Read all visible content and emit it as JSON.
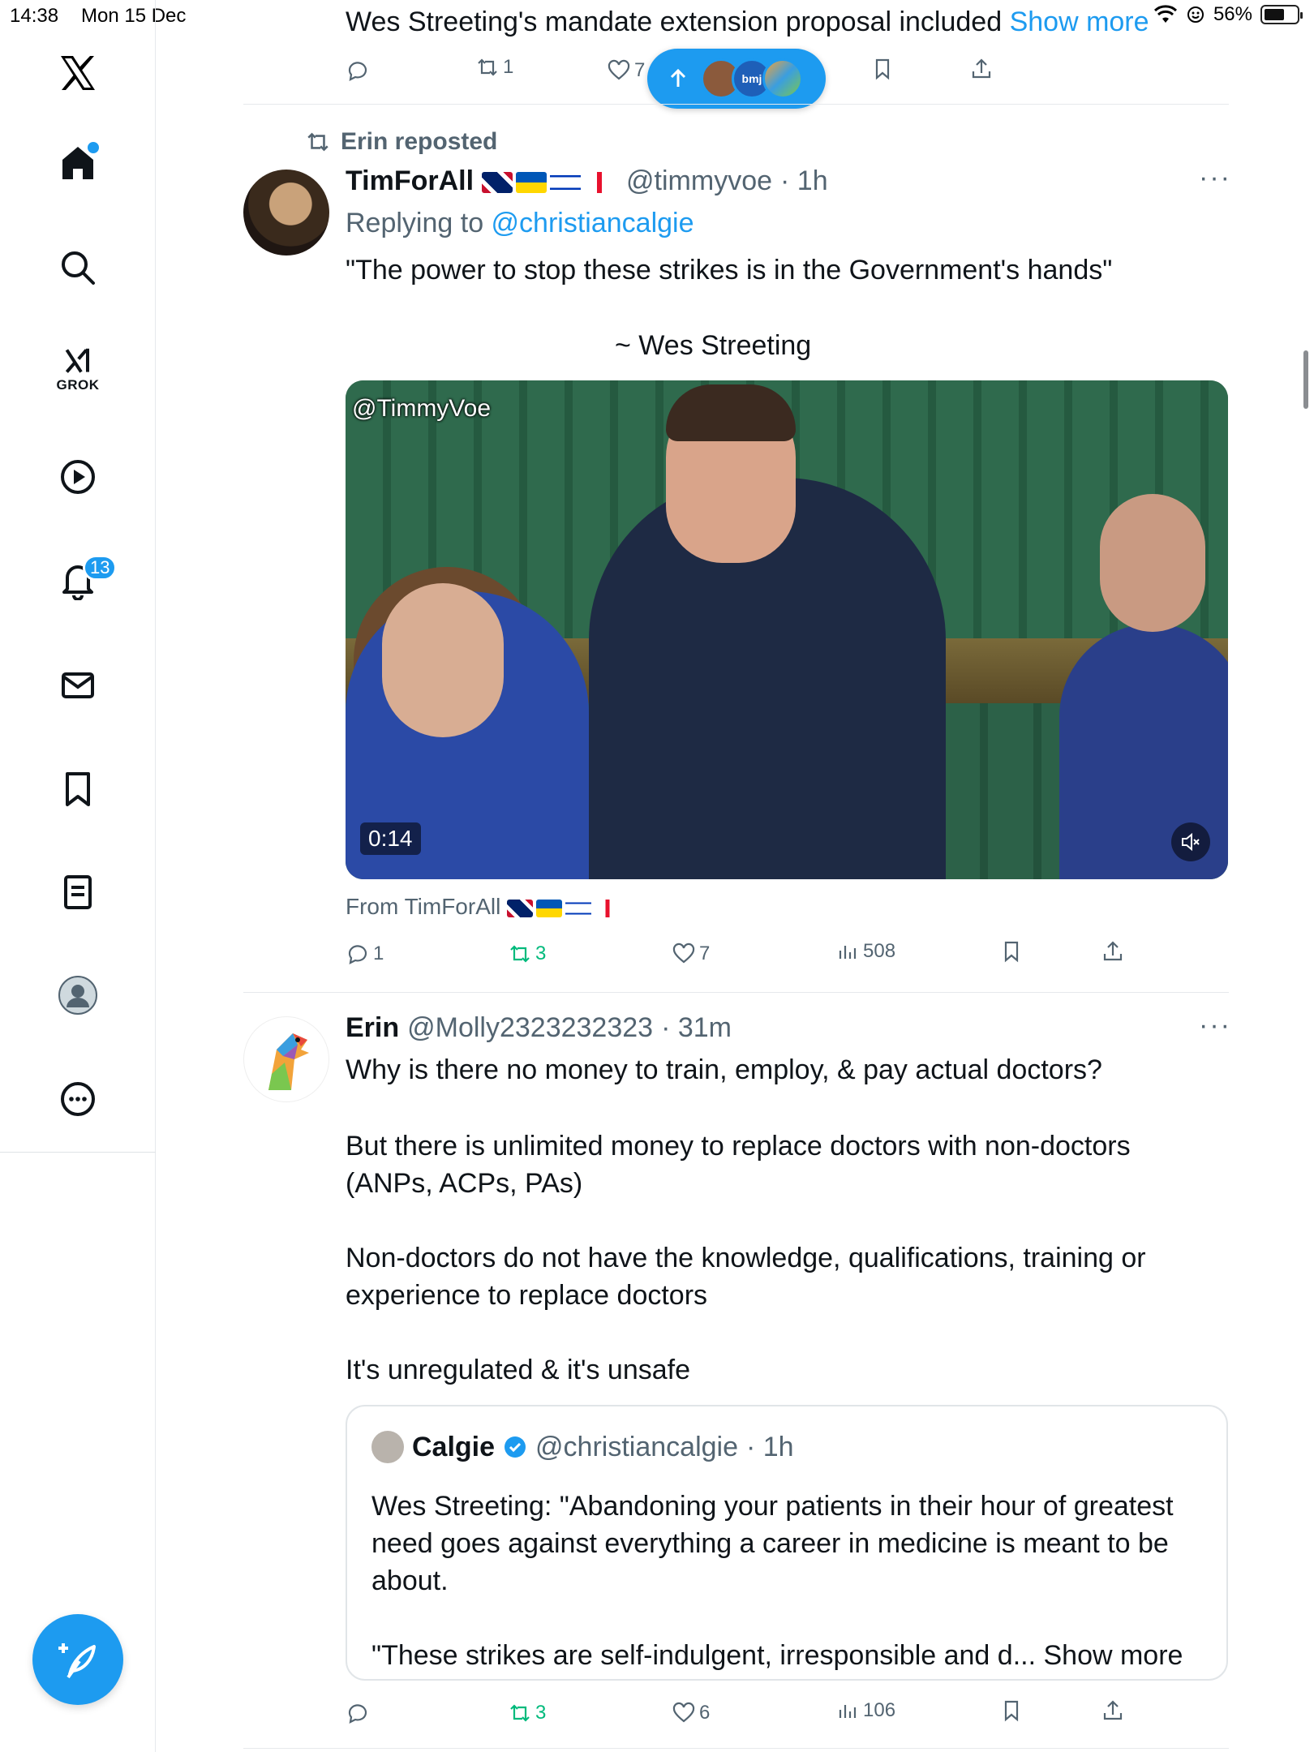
{
  "status_bar": {
    "time": "14:38",
    "date": "Mon 15 Dec",
    "battery": "56%"
  },
  "sidebar": {
    "badge_count": "13",
    "grok_label": "GROK",
    "items": [
      "x-logo",
      "home",
      "search",
      "grok",
      "video",
      "notifications",
      "messages",
      "bookmarks",
      "lists",
      "profile",
      "more"
    ]
  },
  "top_post": {
    "text": "Wes Streeting's mandate extension proposal included ",
    "show_more": "Show more",
    "retweets": "1",
    "likes": "7",
    "new_posts_label": "bmj"
  },
  "post1": {
    "repost_label": "Erin reposted",
    "name": "TimForAll",
    "handle": "@timmyvoe",
    "time": "· 1h",
    "replying_prefix": "Replying to ",
    "replying_to": "@christiancalgie",
    "line1": "\"The power to stop these strikes is in the Government's hands\"",
    "line2": "~ Wes Streeting",
    "media_watermark": "@TimmyVoe",
    "media_duration": "0:14",
    "from_label": "From TimForAll",
    "replies": "1",
    "retweets": "3",
    "likes": "7",
    "views": "508"
  },
  "post2": {
    "name": "Erin",
    "handle": "@Molly2323232323",
    "time": "· 31m",
    "para1": "Why is there no money to train, employ, & pay actual doctors?",
    "para2": "But there is unlimited money to replace doctors with non-doctors (ANPs, ACPs, PAs)",
    "para3": "Non-doctors do not have the knowledge, qualifications, training or experience to replace doctors",
    "para4": "It's unregulated & it's unsafe",
    "quote": {
      "name": "Calgie",
      "handle": "@christiancalgie",
      "time": "· 1h",
      "text1": "Wes Streeting: \"Abandoning your patients in their hour of greatest need goes against everything a career in medicine is meant to be about.",
      "text2": "\"These strikes are self-indulgent, irresponsible and d... Show more"
    },
    "retweets": "3",
    "likes": "6",
    "views": "106"
  },
  "colors": {
    "accent": "#1d9bf0",
    "retweet_green": "#00ba7c",
    "secondary_text": "#536471"
  }
}
